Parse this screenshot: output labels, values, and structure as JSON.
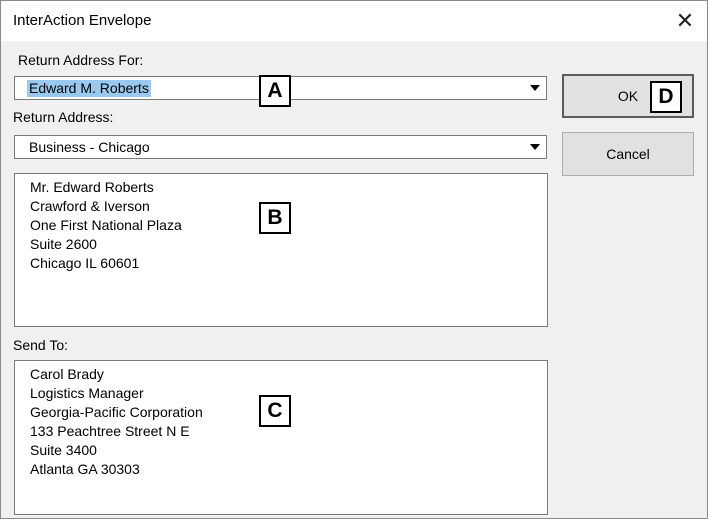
{
  "window": {
    "title": "InterAction Envelope",
    "close_icon": "close-icon"
  },
  "return_address_for": {
    "label": "Return Address For:",
    "value": "Edward M. Roberts"
  },
  "return_address": {
    "label": "Return Address:",
    "value": "Business - Chicago"
  },
  "return_address_text": {
    "lines": [
      "Mr. Edward Roberts",
      "Crawford & Iverson",
      "One First National Plaza",
      "Suite 2600",
      "Chicago IL 60601"
    ]
  },
  "send_to": {
    "label": "Send To:",
    "lines": [
      "Carol Brady",
      "Logistics Manager",
      "Georgia-Pacific Corporation",
      "133 Peachtree Street N E",
      "Suite 3400",
      "Atlanta GA 30303"
    ]
  },
  "buttons": {
    "ok": "OK",
    "cancel": "Cancel"
  },
  "markers": {
    "a": "A",
    "b": "B",
    "c": "C",
    "d": "D"
  },
  "colors": {
    "selection_highlight": "#99c9ef",
    "background": "#f0f0f0"
  }
}
